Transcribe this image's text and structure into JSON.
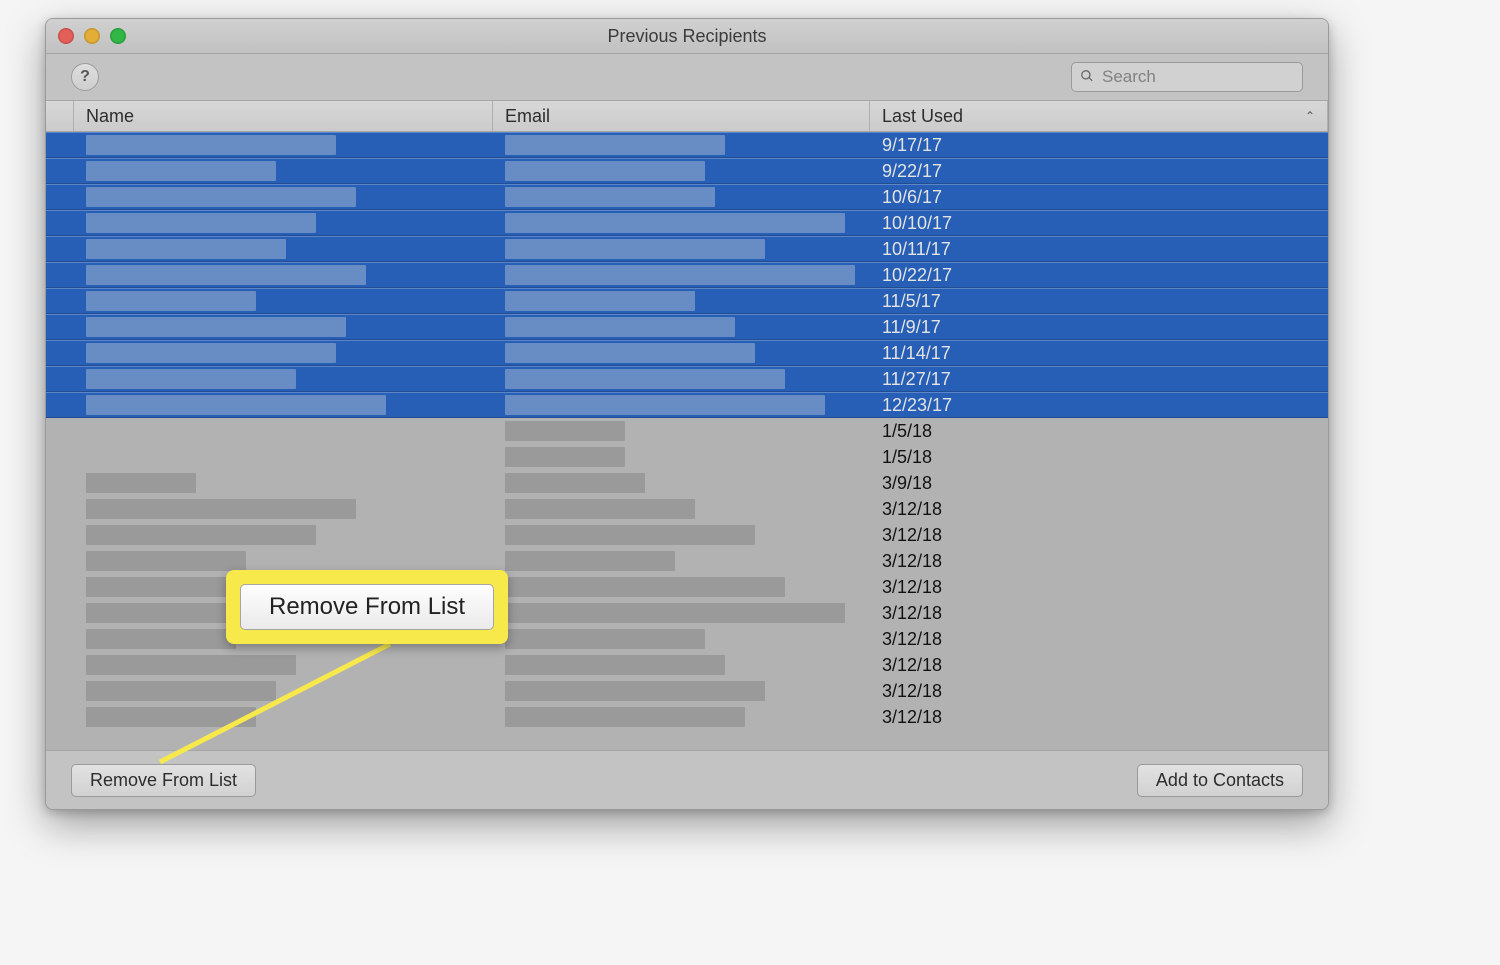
{
  "window": {
    "title": "Previous Recipients"
  },
  "toolbar": {
    "help_label": "?",
    "search_placeholder": "Search",
    "search_value": ""
  },
  "columns": {
    "name": "Name",
    "email": "Email",
    "last_used": "Last Used",
    "sort_column": "Last Used",
    "sort_direction": "ascending"
  },
  "rows": [
    {
      "date": "9/17/17",
      "selected": true,
      "name_w": 250,
      "email_w": 220
    },
    {
      "date": "9/22/17",
      "selected": true,
      "name_w": 190,
      "email_w": 200
    },
    {
      "date": "10/6/17",
      "selected": true,
      "name_w": 270,
      "email_w": 210
    },
    {
      "date": "10/10/17",
      "selected": true,
      "name_w": 230,
      "email_w": 340
    },
    {
      "date": "10/11/17",
      "selected": true,
      "name_w": 200,
      "email_w": 260
    },
    {
      "date": "10/22/17",
      "selected": true,
      "name_w": 280,
      "email_w": 350
    },
    {
      "date": "11/5/17",
      "selected": true,
      "name_w": 170,
      "email_w": 190
    },
    {
      "date": "11/9/17",
      "selected": true,
      "name_w": 260,
      "email_w": 230
    },
    {
      "date": "11/14/17",
      "selected": true,
      "name_w": 250,
      "email_w": 250
    },
    {
      "date": "11/27/17",
      "selected": true,
      "name_w": 210,
      "email_w": 280
    },
    {
      "date": "12/23/17",
      "selected": true,
      "name_w": 300,
      "email_w": 320
    },
    {
      "date": "1/5/18",
      "selected": false,
      "name_w": 0,
      "email_w": 120
    },
    {
      "date": "1/5/18",
      "selected": false,
      "name_w": 0,
      "email_w": 120
    },
    {
      "date": "3/9/18",
      "selected": false,
      "name_w": 110,
      "email_w": 140
    },
    {
      "date": "3/12/18",
      "selected": false,
      "name_w": 270,
      "email_w": 190
    },
    {
      "date": "3/12/18",
      "selected": false,
      "name_w": 230,
      "email_w": 250
    },
    {
      "date": "3/12/18",
      "selected": false,
      "name_w": 160,
      "email_w": 170
    },
    {
      "date": "3/12/18",
      "selected": false,
      "name_w": 200,
      "email_w": 280
    },
    {
      "date": "3/12/18",
      "selected": false,
      "name_w": 280,
      "email_w": 340
    },
    {
      "date": "3/12/18",
      "selected": false,
      "name_w": 150,
      "email_w": 200
    },
    {
      "date": "3/12/18",
      "selected": false,
      "name_w": 210,
      "email_w": 220
    },
    {
      "date": "3/12/18",
      "selected": false,
      "name_w": 190,
      "email_w": 260
    },
    {
      "date": "3/12/18",
      "selected": false,
      "name_w": 170,
      "email_w": 240
    }
  ],
  "buttons": {
    "remove": "Remove From List",
    "add": "Add to Contacts"
  },
  "callout": {
    "label": "Remove From List"
  }
}
